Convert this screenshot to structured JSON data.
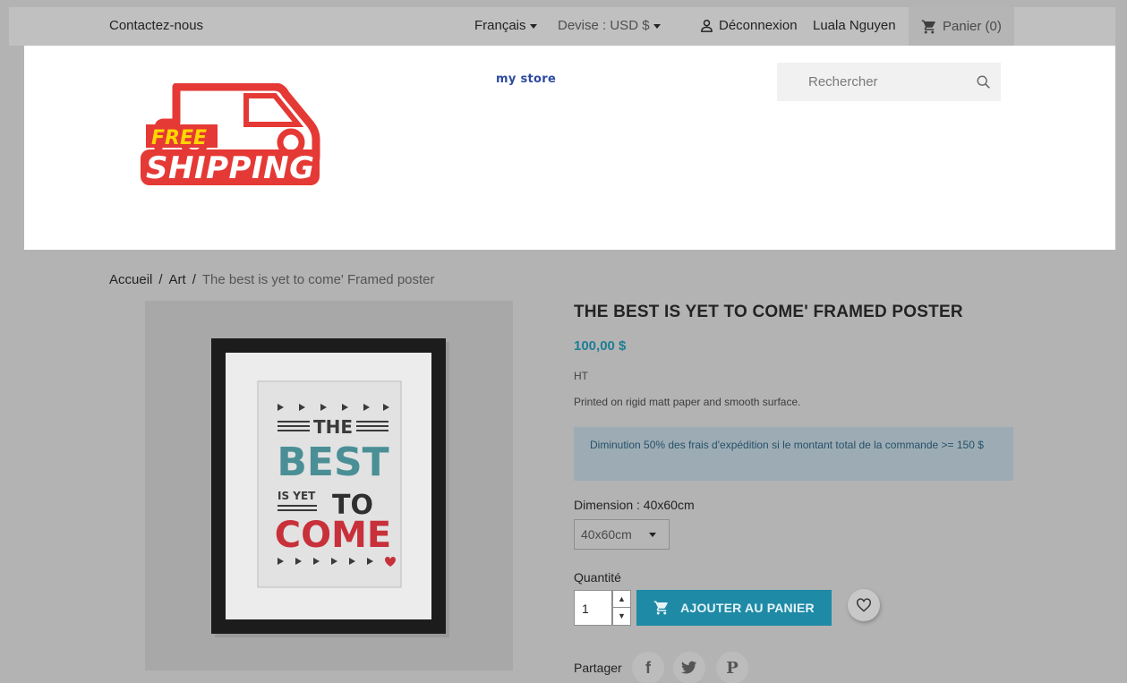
{
  "topbar": {
    "contact": "Contactez-nous",
    "language": "Français",
    "currency": "Devise : USD $",
    "logout": "Déconnexion",
    "user_name": "Luala Nguyen",
    "cart": "Panier (0)"
  },
  "header": {
    "logo_text_top": "FREE",
    "logo_text_bottom": "SHIPPING",
    "store_name": "my store",
    "search_placeholder": "Rechercher"
  },
  "breadcrumb": [
    "Accueil",
    "/",
    "Art",
    "/",
    "The best is yet to come' Framed poster"
  ],
  "poster": {
    "line1": "THE",
    "line2": "BEST",
    "line3a": "IS YET",
    "line3b": "TO",
    "line4": "COME"
  },
  "product": {
    "title": "THE BEST IS YET TO COME' FRAMED POSTER",
    "price": "100,00 $",
    "tax": "HT",
    "description": "Printed on rigid matt paper and smooth surface.",
    "promo": "Diminution 50% des frais d'expédition si le montant total de la commande >= 150 $",
    "dimension_label": "Dimension : 40x60cm",
    "dimension_value": "40x60cm",
    "quantity_label": "Quantité",
    "quantity_value": "1",
    "add_to_cart": "AJOUTER AU PANIER",
    "share_label": "Partager"
  },
  "colors": {
    "accent": "#1f8aa6",
    "price": "#1e7e94",
    "logo_red": "#e53935",
    "logo_yellow": "#ffd600"
  }
}
